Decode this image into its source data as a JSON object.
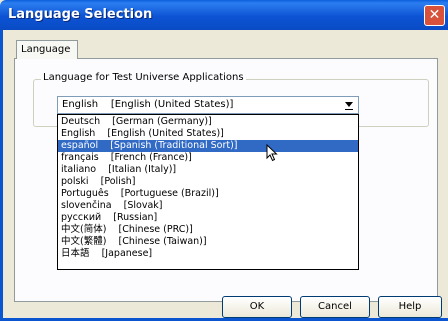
{
  "window": {
    "title": "Language Selection"
  },
  "tabs": [
    {
      "label": "Language"
    }
  ],
  "group": {
    "legend": "Language for Test Universe Applications"
  },
  "combo": {
    "value": "English    [English (United States)]"
  },
  "dropdown": {
    "selected_index": 2,
    "items": [
      "Deutsch    [German (Germany)]",
      "English    [English (United States)]",
      "español    [Spanish (Traditional Sort)]",
      "français    [French (France)]",
      "italiano    [Italian (Italy)]",
      "polski    [Polish]",
      "Português    [Portuguese (Brazil)]",
      "slovenčina    [Slovak]",
      "русский    [Russian]",
      "中文(简体)    [Chinese (PRC)]",
      "中文(繁體)    [Chinese (Taiwan)]",
      "日本語    [Japanese]"
    ]
  },
  "buttons": {
    "ok": "OK",
    "cancel": "Cancel",
    "help": "Help"
  },
  "colors": {
    "title_bar": "#0a5fdc",
    "selection": "#316ac5",
    "close": "#d8513a"
  }
}
